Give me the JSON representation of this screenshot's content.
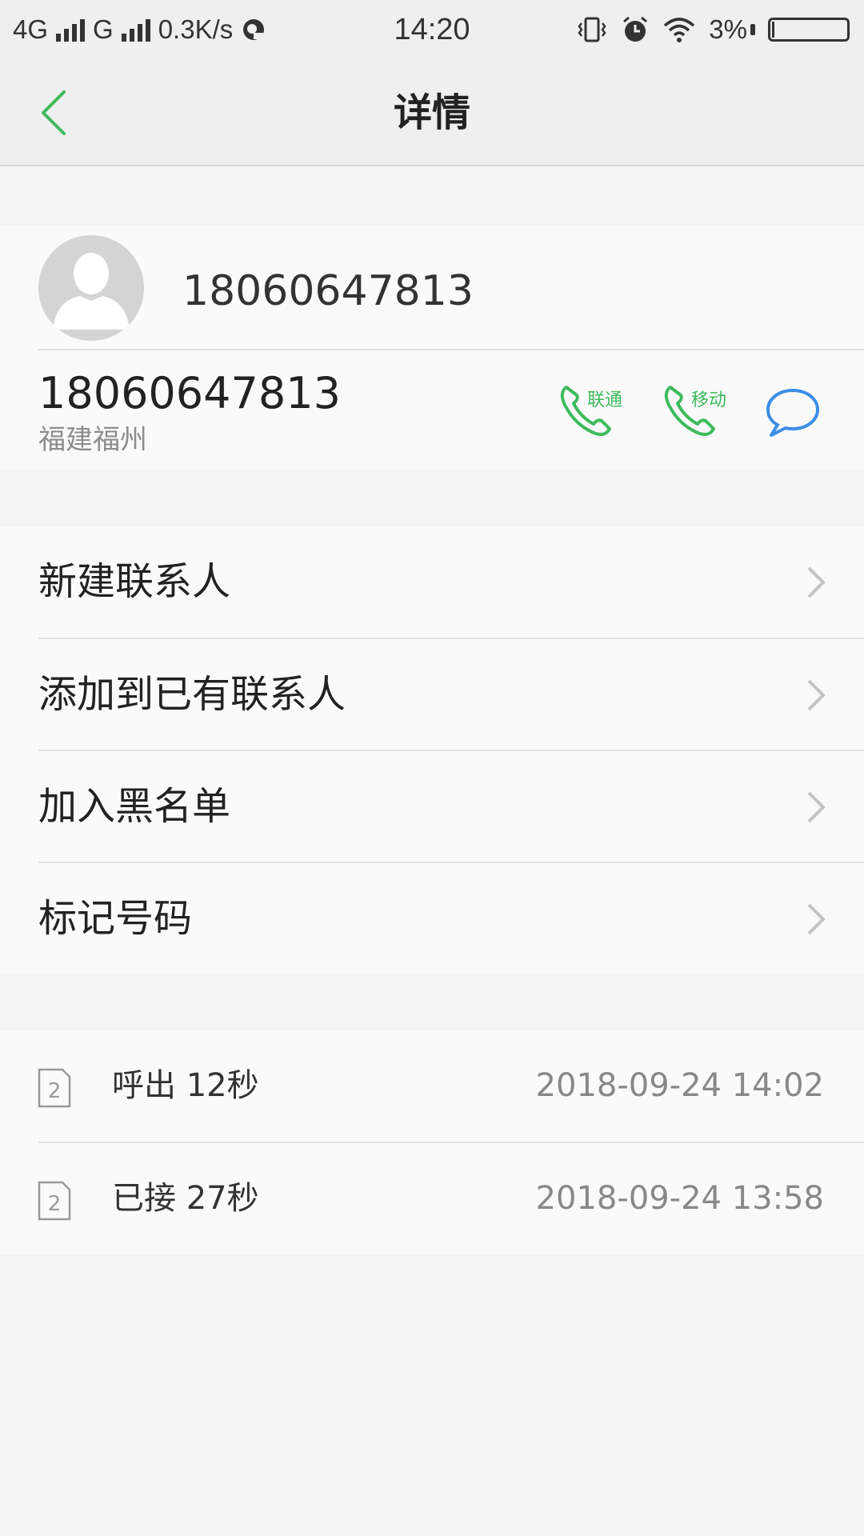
{
  "status_bar": {
    "network1": "4G",
    "network2": "G",
    "speed": "0.3K/s",
    "time": "14:20",
    "battery": "3%",
    "battery_level": 0.03
  },
  "nav": {
    "title": "详情"
  },
  "contact": {
    "name": "18060647813",
    "number": "18060647813",
    "location": "福建福州",
    "actions": [
      {
        "label": "联通",
        "icon": "phone-icon",
        "color": "#3dbb5d"
      },
      {
        "label": "移动",
        "icon": "phone-icon",
        "color": "#3dbb5d"
      },
      {
        "label": "",
        "icon": "message-icon",
        "color": "#3a8ee6"
      }
    ]
  },
  "menu": {
    "items": [
      {
        "label": "新建联系人"
      },
      {
        "label": "添加到已有联系人"
      },
      {
        "label": "加入黑名单"
      },
      {
        "label": "标记号码"
      }
    ]
  },
  "call_log": [
    {
      "sim": "2",
      "type": "呼出 12秒",
      "time": "2018-09-24 14:02"
    },
    {
      "sim": "2",
      "type": "已接 27秒",
      "time": "2018-09-24 13:58"
    }
  ]
}
